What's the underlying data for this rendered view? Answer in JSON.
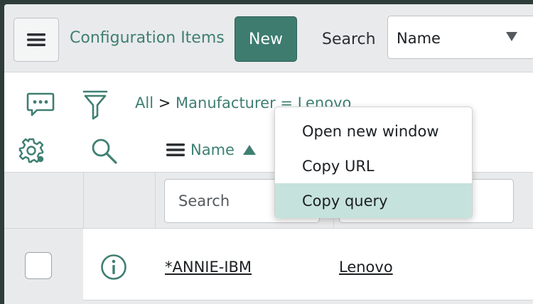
{
  "header": {
    "menu_icon": "hamburger-icon",
    "title": "Configuration Items",
    "new_label": "New",
    "search_label": "Search",
    "search_field_value": "Name"
  },
  "filter": {
    "breadcrumb_all": "All",
    "breadcrumb_separator": ">",
    "breadcrumb_condition": "Manufacturer = Lenovo"
  },
  "columns": {
    "name_label": "Name",
    "sort_direction": "ascending"
  },
  "search_row": {
    "name_placeholder": "Search"
  },
  "rows": [
    {
      "name": "*ANNIE-IBM",
      "manufacturer": "Lenovo"
    }
  ],
  "context_menu": {
    "items": [
      {
        "label": "Open new window"
      },
      {
        "label": "Copy URL"
      },
      {
        "label": "Copy query",
        "highlighted": true
      }
    ]
  },
  "colors": {
    "accent": "#3e7c70",
    "link": "#3f7f72",
    "highlight": "#c6e2dc",
    "background": "#e9eaeb"
  }
}
